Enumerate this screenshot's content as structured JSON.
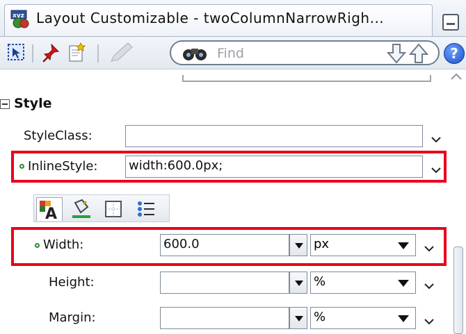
{
  "window": {
    "title": "Layout Customizable - twoColumnNarrowRigh...",
    "icon": "xyz-components-icon"
  },
  "toolbar": {
    "find_placeholder": "Find",
    "help_label": "?",
    "icons": [
      "select-icon",
      "pin-icon",
      "edit-document-icon",
      "pencil-icon",
      "binoculars-icon",
      "down-arrow-icon",
      "up-arrow-icon",
      "help-icon"
    ]
  },
  "style_section": {
    "title": "Style",
    "styleclass": {
      "label": "StyleClass:",
      "value": ""
    },
    "inlinestyle": {
      "label": "InlineStyle:",
      "value": "width:600.0px;"
    },
    "tabs": [
      "text-icon",
      "paint-bucket-icon",
      "border-icon",
      "list-icon"
    ],
    "rows": [
      {
        "label": "Width:",
        "value": "600.0",
        "unit": "px",
        "set": true
      },
      {
        "label": "Height:",
        "value": "",
        "unit": "%",
        "set": false
      },
      {
        "label": "Margin:",
        "value": "",
        "unit": "%",
        "set": false
      }
    ]
  }
}
